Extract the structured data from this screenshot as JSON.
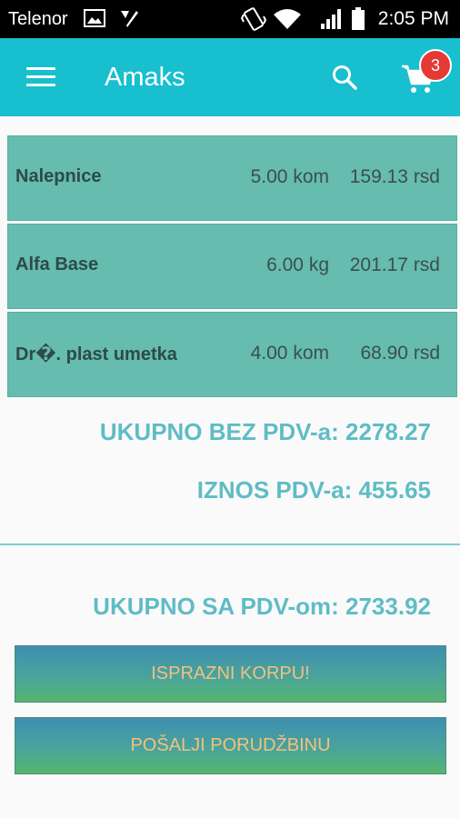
{
  "status_bar": {
    "carrier": "Telenor",
    "time": "2:05 PM",
    "icons": [
      "image-icon",
      "checkmark-app-icon",
      "vibrate-icon",
      "wifi-icon",
      "signal-icon",
      "battery-icon"
    ]
  },
  "app_bar": {
    "title": "Amaks",
    "cart_count": "3",
    "icons": [
      "menu-icon",
      "search-icon",
      "cart-icon"
    ]
  },
  "items": [
    {
      "name": "Nalepnice",
      "qty": "5.00 kom",
      "price": "159.13 rsd"
    },
    {
      "name": "Alfa Base",
      "qty": "6.00 kg",
      "price": "201.17 rsd"
    },
    {
      "name": "Dr�. plast umetka",
      "qty": "4.00 kom",
      "price": "68.90 rsd"
    }
  ],
  "totals": {
    "without_vat": "UKUPNO BEZ PDV-a: 2278.27",
    "vat_amount": "IZNOS PDV-a: 455.65",
    "with_vat": "UKUPNO SA PDV-om: 2733.92"
  },
  "buttons": {
    "empty_cart": "ISPRAZNI KORPU!",
    "send_order": "POŠALJI PORUDŽBINU"
  },
  "colors": {
    "app_bar": "#18bfcf",
    "row_bg": "#65bcaf",
    "totals_text": "#5fbcc6",
    "badge": "#e53935",
    "button_text": "#f1c27d"
  }
}
